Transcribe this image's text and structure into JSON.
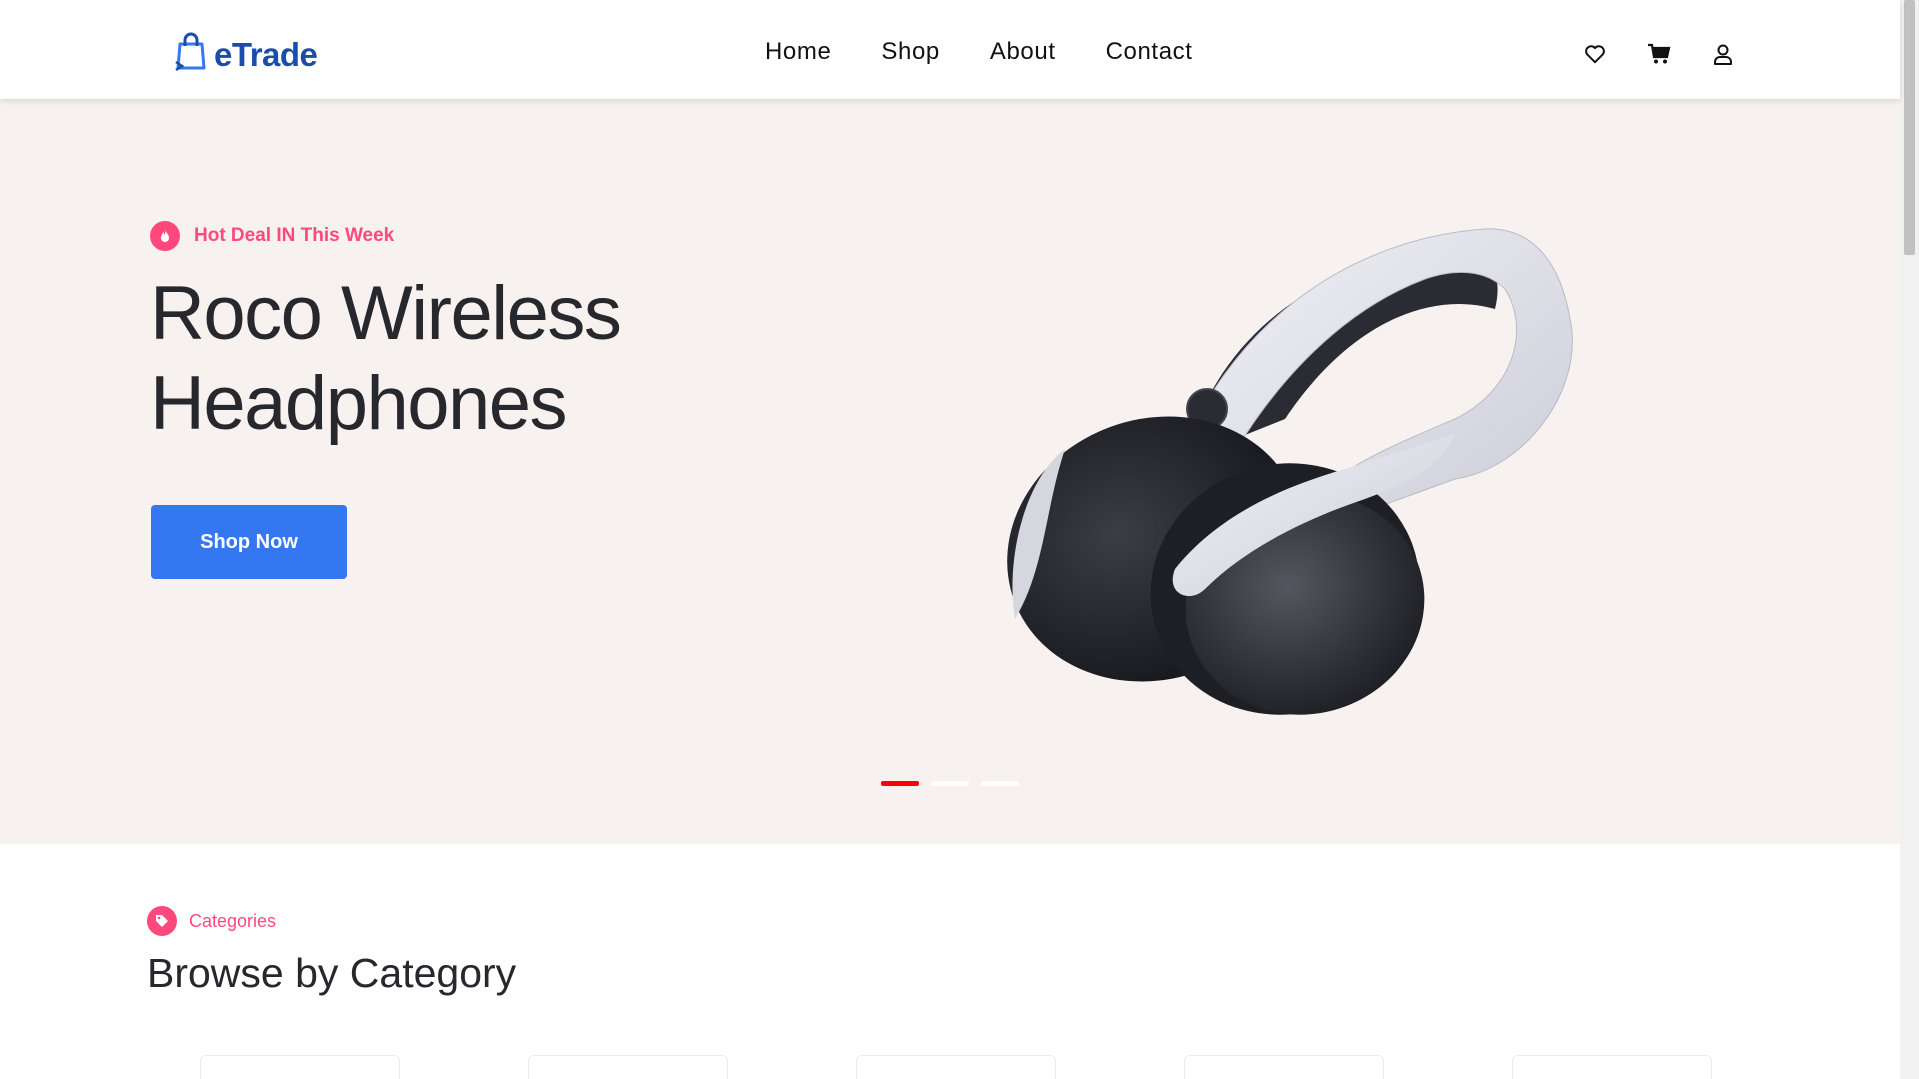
{
  "header": {
    "logo_text": "eTrade",
    "nav": [
      "Home",
      "Shop",
      "About",
      "Contact"
    ],
    "icons": [
      "heart-icon",
      "cart-icon",
      "user-icon"
    ]
  },
  "hero": {
    "deal_label": "Hot Deal IN This Week",
    "title": "Roco Wireless Headphones",
    "button_label": "Shop Now",
    "slider_active_index": 0,
    "slider_count": 3
  },
  "categories": {
    "label": "Categories",
    "title": "Browse by Category",
    "visible_cards": 5
  },
  "colors": {
    "accent": "#3577f0",
    "hot": "#ff497c",
    "hero_bg": "#f7f2ef",
    "logo": "#1b4da8",
    "active_dot": "#ff0000"
  }
}
